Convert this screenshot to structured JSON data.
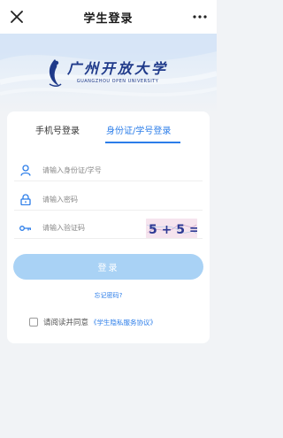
{
  "nav": {
    "title": "学生登录",
    "close_icon": "close-icon",
    "more_icon": "more-icon"
  },
  "logo": {
    "name_cn": "广州开放大学",
    "name_en": "GUANGZHOU OPEN UNIVERSITY",
    "brand_color": "#1f3a8a"
  },
  "tabs": [
    {
      "label": "手机号登录",
      "active": false
    },
    {
      "label": "身份证/学号登录",
      "active": true
    }
  ],
  "form": {
    "id_placeholder": "请输入身份证/学号",
    "password_placeholder": "请输入密码",
    "code_placeholder": "请输入验证码",
    "captcha_text": "5 + 5 ="
  },
  "login_button": "登录",
  "forgot_password": "忘记密码?",
  "agreement": {
    "text": "请阅读并同意",
    "link": "《学生隐私服务协议》"
  },
  "colors": {
    "accent": "#2b7de9",
    "button": "#a9d2f5",
    "background": "#f1f3f6"
  }
}
